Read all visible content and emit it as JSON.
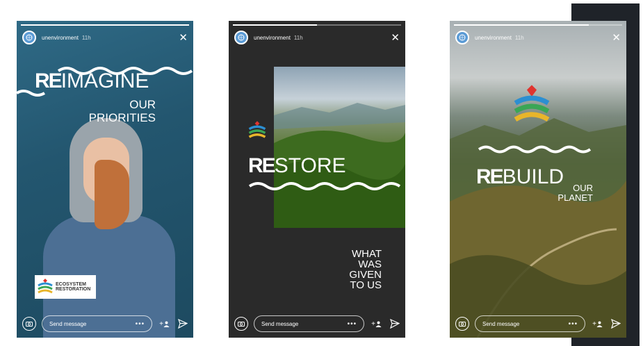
{
  "stories": [
    {
      "username": "unenvironment",
      "time": "11h",
      "progress": 1.0,
      "headline_re": "RE",
      "headline_word": "IMAGINE",
      "headline_sub": [
        "OUR",
        "PRIORITIES"
      ],
      "badge_text": [
        "ECOSYSTEM",
        "RESTORATION"
      ],
      "message_placeholder": "Send message"
    },
    {
      "username": "unenvironment",
      "time": "11h",
      "progress": 0.5,
      "headline_re": "RE",
      "headline_word": "STORE",
      "headline_sub": [
        "WHAT",
        "WAS",
        "GIVEN",
        "TO US"
      ],
      "message_placeholder": "Send message"
    },
    {
      "username": "unenvironment",
      "time": "11h",
      "progress": 0.8,
      "headline_re": "RE",
      "headline_word": "BUILD",
      "headline_sub": [
        "OUR",
        "PLANET"
      ],
      "message_placeholder": "Send message"
    }
  ],
  "icons": {
    "close": "close-icon",
    "camera": "camera-icon",
    "more": "more-icon",
    "add_person": "add-person-icon",
    "send": "send-icon"
  },
  "colors": {
    "logo_red": "#e0342f",
    "logo_blue": "#2c8fd1",
    "logo_green": "#3aa655",
    "logo_yellow": "#e8b52b"
  },
  "labels": {
    "dots": "•••",
    "add": "+"
  }
}
